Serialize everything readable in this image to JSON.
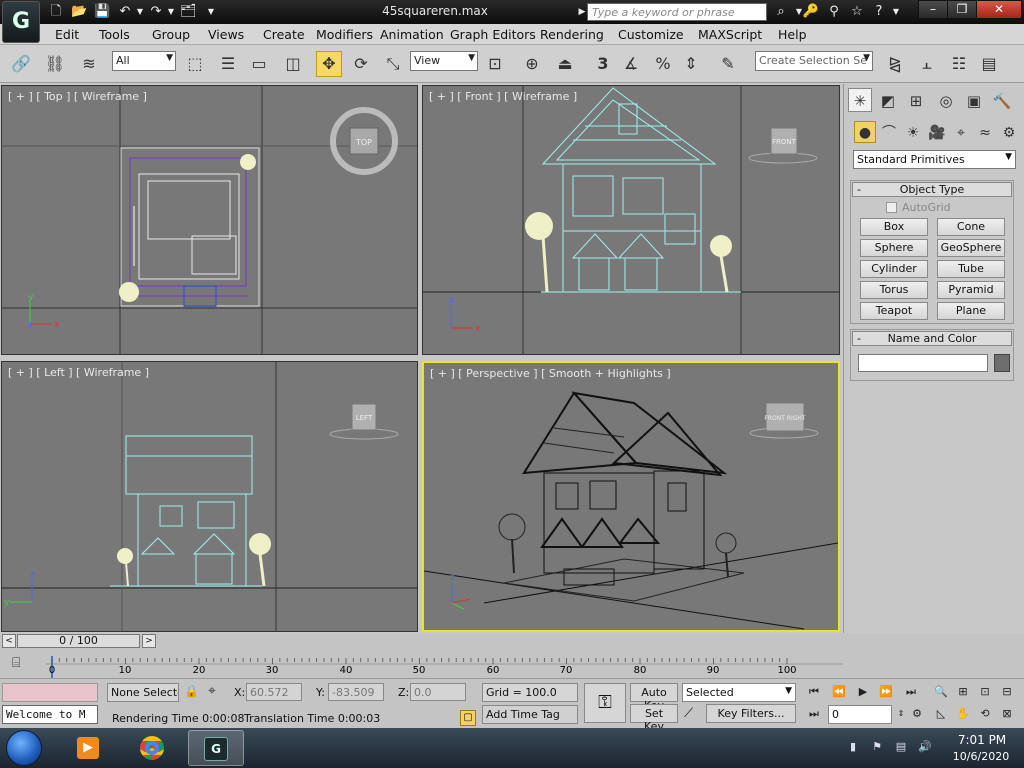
{
  "window": {
    "file_title": "45squareren.max",
    "search_placeholder": "Type a keyword or phrase",
    "logo_letter": "G",
    "buttons": {
      "minimize": "–",
      "restore": "❐",
      "close": "✕"
    }
  },
  "menu": [
    "Edit",
    "Tools",
    "Group",
    "Views",
    "Create",
    "Modifiers",
    "Animation",
    "Graph Editors",
    "Rendering",
    "Customize",
    "MAXScript",
    "Help"
  ],
  "toolbar": {
    "selection_filter": "All",
    "reference_coord": "View",
    "named_selection_placeholder": "Create Selection Se",
    "snap_label": "3",
    "active_tool": "select-and-move"
  },
  "viewports": {
    "top": {
      "label": "[ + ] [ Top ] [ Wireframe ]",
      "cube": "TOP"
    },
    "front": {
      "label": "[ + ] [ Front ] [ Wireframe ]",
      "cube": "FRONT"
    },
    "left": {
      "label": "[ + ] [ Left ] [ Wireframe ]",
      "cube": "LEFT"
    },
    "perspective": {
      "label": "[ + ] [ Perspective ] [ Smooth + Highlights ]",
      "cube": "FRONT RIGHT"
    },
    "axes": {
      "x": "x",
      "y": "y",
      "z": "z"
    }
  },
  "command_panel": {
    "primitive_type": "Standard Primitives",
    "object_type_title": "Object Type",
    "autogrid_label": "AutoGrid",
    "primitives": [
      "Box",
      "Cone",
      "Sphere",
      "GeoSphere",
      "Cylinder",
      "Tube",
      "Torus",
      "Pyramid",
      "Teapot",
      "Plane"
    ],
    "name_color_title": "Name and Color",
    "collapse_symbol": "-"
  },
  "timeline": {
    "frame_display": "0 / 100",
    "ticks": [
      "0",
      "10",
      "20",
      "30",
      "40",
      "50",
      "60",
      "70",
      "80",
      "90",
      "100"
    ],
    "prev": "<",
    "next": ">"
  },
  "status": {
    "welcome": "Welcome to M",
    "none_selected": "None Selected",
    "x_label": "X:",
    "x_value": "60.572",
    "y_label": "Y:",
    "y_value": "-83.509",
    "z_label": "Z:",
    "z_value": "0.0",
    "grid": "Grid = 100.0",
    "auto_key": "Auto Key",
    "set_key": "Set Key",
    "key_mode": "Selected",
    "key_filters": "Key Filters...",
    "frame_value": "0",
    "rendering_time": "Rendering Time  0:00:08",
    "translation_time": "Translation Time  0:00:03",
    "add_time_tag": "Add Time Tag"
  },
  "taskbar": {
    "time": "7:01 PM",
    "date": "10/6/2020"
  }
}
